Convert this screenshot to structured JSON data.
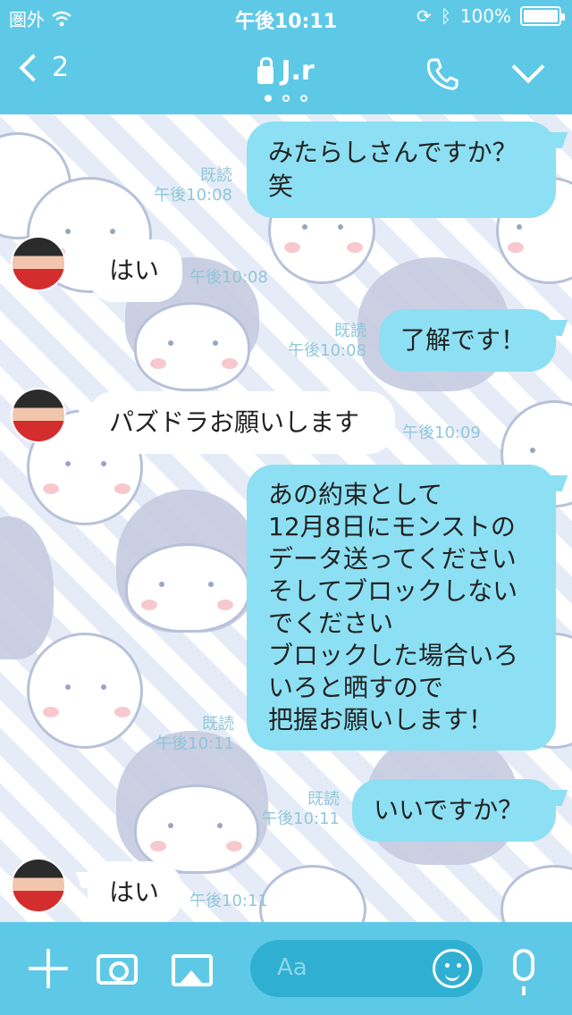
{
  "status": {
    "carrier": "圏外",
    "time": "午後10:11",
    "battery": "100%"
  },
  "nav": {
    "back_count": "2",
    "title": "J.r"
  },
  "messages": [
    {
      "type": "out",
      "text": "みたらしさんですか？\n笑",
      "read": "既読",
      "time": "午後10:08"
    },
    {
      "type": "in",
      "text": "はい",
      "time": "午後10:08"
    },
    {
      "type": "out",
      "text": "了解です！",
      "read": "既読",
      "time": "午後10:08"
    },
    {
      "type": "in",
      "text": "パズドラお願いします",
      "time": "午後10:09"
    },
    {
      "type": "out",
      "text": "あの約束として\n12月8日にモンストの\nデータ送ってください\nそしてブロックしない\nでください\nブロックした場合いろ\nいろと晒すので\n把握お願いします！",
      "read": "既読",
      "time": "午後10:11"
    },
    {
      "type": "out",
      "text": "いいですか？",
      "read": "既読",
      "time": "午後10:11"
    },
    {
      "type": "in",
      "text": "はい",
      "time": "午後10:11"
    }
  ],
  "composer": {
    "placeholder": "Aa"
  },
  "colors": {
    "bar": "#5ec9e6",
    "outgoing_bubble": "#8de0f3",
    "incoming_bubble": "#ffffff"
  }
}
